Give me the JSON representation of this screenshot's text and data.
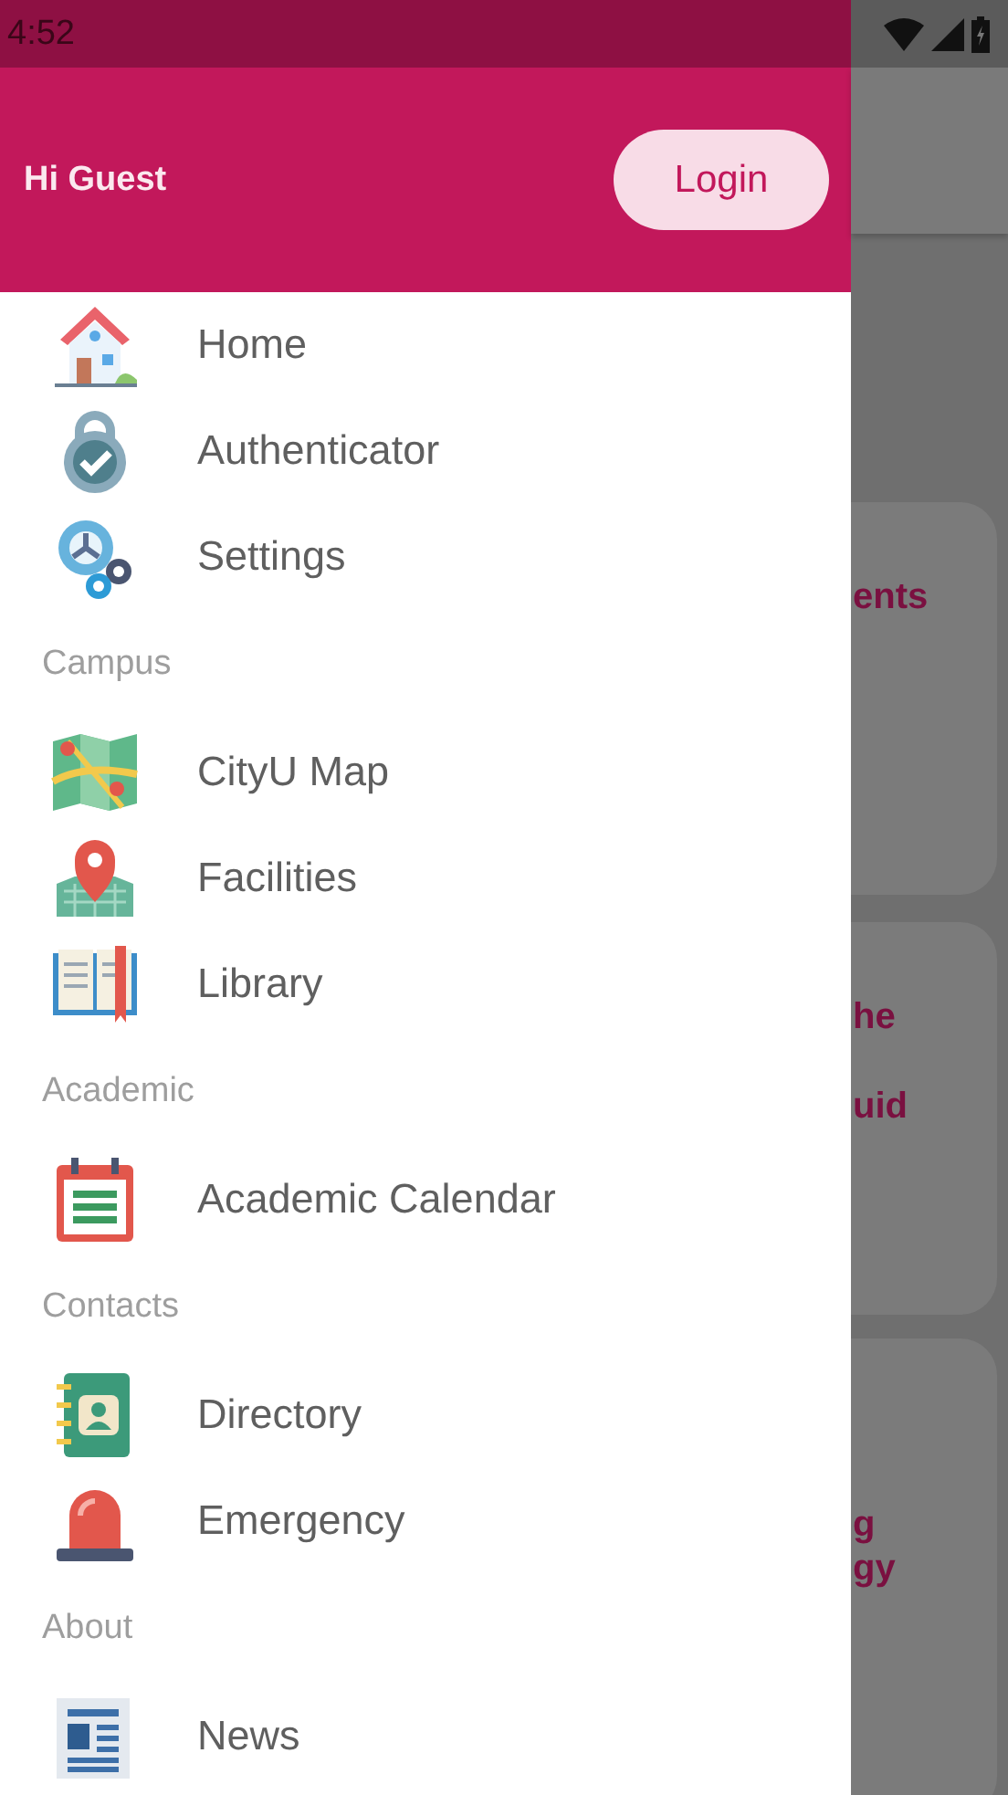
{
  "status_bar": {
    "time": "4:52"
  },
  "drawer": {
    "greeting": "Hi Guest",
    "login_button": "Login",
    "sections": [
      {
        "items": [
          "Home",
          "Authenticator",
          "Settings"
        ]
      },
      {
        "title": "Campus",
        "items": [
          "CityU Map",
          "Facilities",
          "Library"
        ]
      },
      {
        "title": "Academic",
        "items": [
          "Academic Calendar"
        ]
      },
      {
        "title": "Contacts",
        "items": [
          "Directory",
          "Emergency"
        ]
      },
      {
        "title": "About",
        "items": [
          "News"
        ]
      }
    ]
  },
  "background_cards": [
    {
      "lines": [
        "ents"
      ]
    },
    {
      "lines": [
        "he",
        "uid"
      ]
    },
    {
      "lines": [
        "g",
        "gy"
      ]
    }
  ]
}
